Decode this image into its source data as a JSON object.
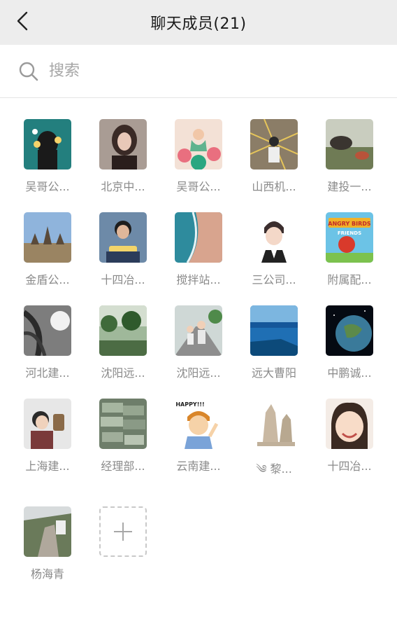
{
  "header": {
    "title": "聊天成员(21)"
  },
  "search": {
    "placeholder": "搜索"
  },
  "members": [
    {
      "name": "吴哥公..."
    },
    {
      "name": "北京中..."
    },
    {
      "name": "吴哥公..."
    },
    {
      "name": "山西机..."
    },
    {
      "name": "建投一..."
    },
    {
      "name": "金盾公..."
    },
    {
      "name": "十四冶..."
    },
    {
      "name": "搅拌站..."
    },
    {
      "name": "三公司..."
    },
    {
      "name": "附属配..."
    },
    {
      "name": "河北建..."
    },
    {
      "name": "沈阳远..."
    },
    {
      "name": "沈阳远..."
    },
    {
      "name": "远大曹阳"
    },
    {
      "name": "中鹏诚..."
    },
    {
      "name": "上海建..."
    },
    {
      "name": "经理部..."
    },
    {
      "name": "云南建..."
    },
    {
      "name": "༄ 黎..."
    },
    {
      "name": "十四冶..."
    },
    {
      "name": "杨海青"
    }
  ],
  "avatar_texts": {
    "m5": "ANGRY BIRDS",
    "m10": "FRIENDS",
    "m13": "HAPPY!!!"
  }
}
